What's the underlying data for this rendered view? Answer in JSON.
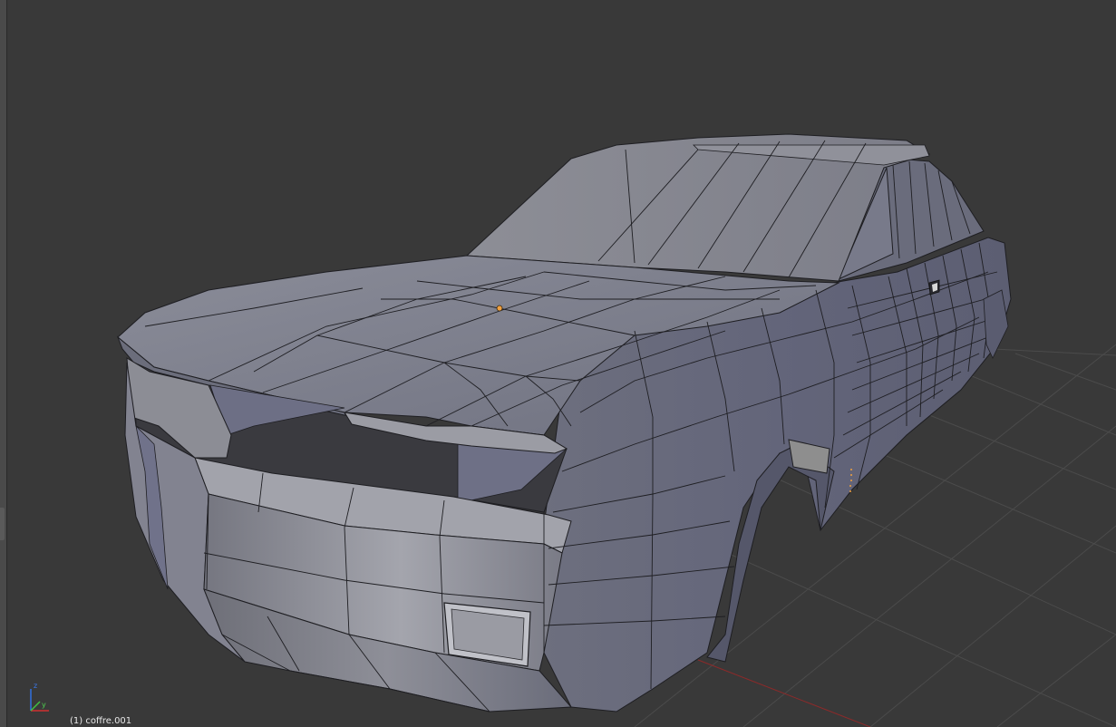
{
  "viewport": {
    "object_label": "(1) coffre.001",
    "background_color": "#393939",
    "grid_color": "#4b4b4b",
    "x_axis_color": "#8c2a2a",
    "mesh_color": "#7d7f8c",
    "edge_color": "#1e1e22",
    "origin_color": "#f0a040"
  },
  "axis_gizmo": {
    "z_label": "z",
    "y_label": "y",
    "x_color": "#d03030",
    "y_color": "#40c040",
    "z_color": "#3070e0"
  }
}
